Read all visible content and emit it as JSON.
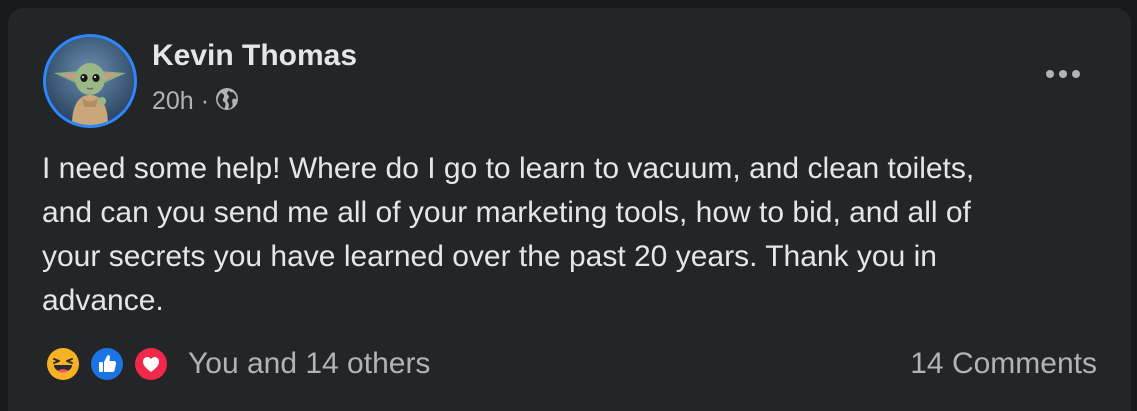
{
  "post": {
    "author": "Kevin Thomas",
    "timestamp": "20h",
    "separator": "·",
    "audience_icon": "globe-icon",
    "avatar_icon": "baby-alien-avatar",
    "more_icon": "more-options-icon",
    "body_lines": [
      "I need some help! Where do I go to learn to vacuum, and clean toilets,",
      "and can you send me all of your marketing tools, how to bid, and all of",
      "your secrets you have learned over the past 20 years. Thank you in",
      "advance."
    ]
  },
  "engagement": {
    "reaction_icons": [
      "haha-icon",
      "like-icon",
      "love-icon"
    ],
    "reactions_text": "You and 14 others",
    "comments_text": "14 Comments"
  },
  "colors": {
    "page_background": "#18191a",
    "card_background": "#242526",
    "primary_text": "#e4e6eb",
    "secondary_text": "#b0b3b8",
    "accent_blue": "#2d88ff",
    "love_red": "#f02849",
    "haha_yellow": "#f7b125"
  }
}
